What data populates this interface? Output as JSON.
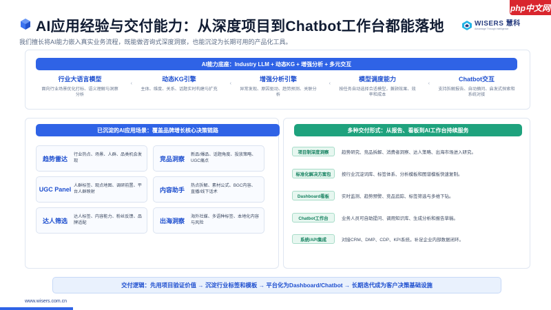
{
  "header": {
    "title": "AI应用经验与交付能力：从深度项目到Chatbot工作台都能落地",
    "subtitle": "我们擅长将AI能力嵌入真实业务流程，既能做咨询式深度洞察，也能沉淀为长期可用的产品化工具。",
    "logo_icon": "blue-cube-icon"
  },
  "brand": {
    "name": "WISERS 慧科",
    "tagline": "Advantage Through Intelligence",
    "colors": {
      "primary": "#2a3f80",
      "accent": "#23b4e6"
    }
  },
  "watermark": {
    "label": "php中文网"
  },
  "capability": {
    "banner": "AI能力底座：Industry  LLM + 动态KG + 增强分析 + 多元交互",
    "items": [
      {
        "title": "行业大语言模型",
        "desc": "面向行业场景优化打标、语义理解与洞察分析"
      },
      {
        "title": "动态KG引擎",
        "desc": "主体、维度、关系、话题实时构建与扩充"
      },
      {
        "title": "增强分析引擎",
        "desc": "异常发现、原因驱动、趋势预测、关联分析"
      },
      {
        "title": "模型调度能力",
        "desc": "按任务自动选择合适模型，兼顾效果、效率和成本"
      },
      {
        "title": "Chatbot交互",
        "desc": "支持拆解报告、自动摘问、启发式探索和系统对接"
      }
    ],
    "separator": "‹"
  },
  "scenarios": {
    "heading": "已沉淀的AI应用场景：覆盖品牌增长核心决策链路",
    "items": [
      {
        "title": "趋势雷达",
        "desc": "行业热点、场景、人群、品类机会发现"
      },
      {
        "title": "竞品洞察",
        "desc": "新品/爆品、话题角度、投放策略、UGC痛点"
      },
      {
        "title": "UGC Panel",
        "desc": "人群标签、观点地图、调研前置、平台人群映射"
      },
      {
        "title": "内容助手",
        "desc": "热点拆解、素材公式、BGC内容、直播/线下话术"
      },
      {
        "title": "达人筛选",
        "desc": "达人标签、内容能力、粉丝反馈、品牌适配"
      },
      {
        "title": "出海洞察",
        "desc": "海外社媒、多语种标签、本地化内容与风险"
      }
    ]
  },
  "delivery": {
    "heading": "多种交付形式：从报告、看板到AI工作台持续服务",
    "items": [
      {
        "tag": "项目制深度洞察",
        "desc": "趋势研究、竞品拆解、消费者洞察、达人策略、出海市场进入研究。"
      },
      {
        "tag": "标准化解决方案包",
        "desc": "按行业沉淀词库、标签体系、分析模板和图谱模板快速复制。"
      },
      {
        "tag": "Dashboard看板",
        "desc": "实时监测、趋势预警、竞品追踪、标签筛选与多维下钻。"
      },
      {
        "tag": "Chatbot工作台",
        "desc": "业务人员可自助提问、调用知识库、生成分析和报告草稿。"
      },
      {
        "tag": "系统/API集成",
        "desc": "对接CRM、DMP、CDP、KPI系统，补足企业内部数据闭环。"
      }
    ]
  },
  "flow": {
    "text": "交付逻辑：先用项目验证价值 → 沉淀行业标签和模板 → 平台化为Dashboard/Chatbot → 长期迭代成为客户决策基础设施"
  },
  "footer": {
    "url": "www.wisers.com.cn"
  }
}
